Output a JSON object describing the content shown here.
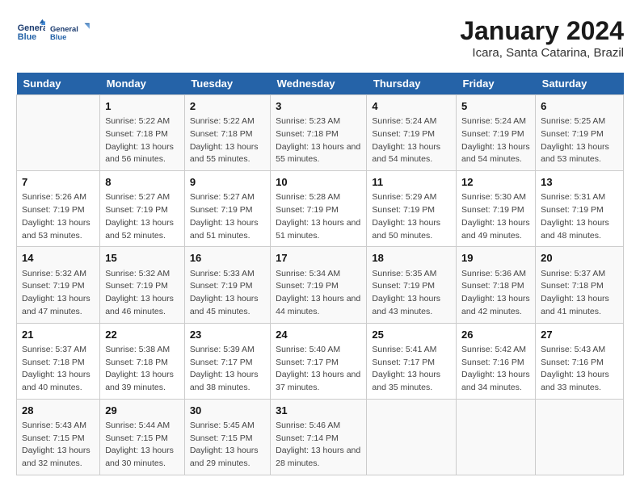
{
  "header": {
    "logo_line1": "General",
    "logo_line2": "Blue",
    "title": "January 2024",
    "subtitle": "Icara, Santa Catarina, Brazil"
  },
  "columns": [
    "Sunday",
    "Monday",
    "Tuesday",
    "Wednesday",
    "Thursday",
    "Friday",
    "Saturday"
  ],
  "weeks": [
    [
      {
        "day": "",
        "sunrise": "",
        "sunset": "",
        "daylight": ""
      },
      {
        "day": "1",
        "sunrise": "Sunrise: 5:22 AM",
        "sunset": "Sunset: 7:18 PM",
        "daylight": "Daylight: 13 hours and 56 minutes."
      },
      {
        "day": "2",
        "sunrise": "Sunrise: 5:22 AM",
        "sunset": "Sunset: 7:18 PM",
        "daylight": "Daylight: 13 hours and 55 minutes."
      },
      {
        "day": "3",
        "sunrise": "Sunrise: 5:23 AM",
        "sunset": "Sunset: 7:18 PM",
        "daylight": "Daylight: 13 hours and 55 minutes."
      },
      {
        "day": "4",
        "sunrise": "Sunrise: 5:24 AM",
        "sunset": "Sunset: 7:19 PM",
        "daylight": "Daylight: 13 hours and 54 minutes."
      },
      {
        "day": "5",
        "sunrise": "Sunrise: 5:24 AM",
        "sunset": "Sunset: 7:19 PM",
        "daylight": "Daylight: 13 hours and 54 minutes."
      },
      {
        "day": "6",
        "sunrise": "Sunrise: 5:25 AM",
        "sunset": "Sunset: 7:19 PM",
        "daylight": "Daylight: 13 hours and 53 minutes."
      }
    ],
    [
      {
        "day": "7",
        "sunrise": "Sunrise: 5:26 AM",
        "sunset": "Sunset: 7:19 PM",
        "daylight": "Daylight: 13 hours and 53 minutes."
      },
      {
        "day": "8",
        "sunrise": "Sunrise: 5:27 AM",
        "sunset": "Sunset: 7:19 PM",
        "daylight": "Daylight: 13 hours and 52 minutes."
      },
      {
        "day": "9",
        "sunrise": "Sunrise: 5:27 AM",
        "sunset": "Sunset: 7:19 PM",
        "daylight": "Daylight: 13 hours and 51 minutes."
      },
      {
        "day": "10",
        "sunrise": "Sunrise: 5:28 AM",
        "sunset": "Sunset: 7:19 PM",
        "daylight": "Daylight: 13 hours and 51 minutes."
      },
      {
        "day": "11",
        "sunrise": "Sunrise: 5:29 AM",
        "sunset": "Sunset: 7:19 PM",
        "daylight": "Daylight: 13 hours and 50 minutes."
      },
      {
        "day": "12",
        "sunrise": "Sunrise: 5:30 AM",
        "sunset": "Sunset: 7:19 PM",
        "daylight": "Daylight: 13 hours and 49 minutes."
      },
      {
        "day": "13",
        "sunrise": "Sunrise: 5:31 AM",
        "sunset": "Sunset: 7:19 PM",
        "daylight": "Daylight: 13 hours and 48 minutes."
      }
    ],
    [
      {
        "day": "14",
        "sunrise": "Sunrise: 5:32 AM",
        "sunset": "Sunset: 7:19 PM",
        "daylight": "Daylight: 13 hours and 47 minutes."
      },
      {
        "day": "15",
        "sunrise": "Sunrise: 5:32 AM",
        "sunset": "Sunset: 7:19 PM",
        "daylight": "Daylight: 13 hours and 46 minutes."
      },
      {
        "day": "16",
        "sunrise": "Sunrise: 5:33 AM",
        "sunset": "Sunset: 7:19 PM",
        "daylight": "Daylight: 13 hours and 45 minutes."
      },
      {
        "day": "17",
        "sunrise": "Sunrise: 5:34 AM",
        "sunset": "Sunset: 7:19 PM",
        "daylight": "Daylight: 13 hours and 44 minutes."
      },
      {
        "day": "18",
        "sunrise": "Sunrise: 5:35 AM",
        "sunset": "Sunset: 7:19 PM",
        "daylight": "Daylight: 13 hours and 43 minutes."
      },
      {
        "day": "19",
        "sunrise": "Sunrise: 5:36 AM",
        "sunset": "Sunset: 7:18 PM",
        "daylight": "Daylight: 13 hours and 42 minutes."
      },
      {
        "day": "20",
        "sunrise": "Sunrise: 5:37 AM",
        "sunset": "Sunset: 7:18 PM",
        "daylight": "Daylight: 13 hours and 41 minutes."
      }
    ],
    [
      {
        "day": "21",
        "sunrise": "Sunrise: 5:37 AM",
        "sunset": "Sunset: 7:18 PM",
        "daylight": "Daylight: 13 hours and 40 minutes."
      },
      {
        "day": "22",
        "sunrise": "Sunrise: 5:38 AM",
        "sunset": "Sunset: 7:18 PM",
        "daylight": "Daylight: 13 hours and 39 minutes."
      },
      {
        "day": "23",
        "sunrise": "Sunrise: 5:39 AM",
        "sunset": "Sunset: 7:17 PM",
        "daylight": "Daylight: 13 hours and 38 minutes."
      },
      {
        "day": "24",
        "sunrise": "Sunrise: 5:40 AM",
        "sunset": "Sunset: 7:17 PM",
        "daylight": "Daylight: 13 hours and 37 minutes."
      },
      {
        "day": "25",
        "sunrise": "Sunrise: 5:41 AM",
        "sunset": "Sunset: 7:17 PM",
        "daylight": "Daylight: 13 hours and 35 minutes."
      },
      {
        "day": "26",
        "sunrise": "Sunrise: 5:42 AM",
        "sunset": "Sunset: 7:16 PM",
        "daylight": "Daylight: 13 hours and 34 minutes."
      },
      {
        "day": "27",
        "sunrise": "Sunrise: 5:43 AM",
        "sunset": "Sunset: 7:16 PM",
        "daylight": "Daylight: 13 hours and 33 minutes."
      }
    ],
    [
      {
        "day": "28",
        "sunrise": "Sunrise: 5:43 AM",
        "sunset": "Sunset: 7:15 PM",
        "daylight": "Daylight: 13 hours and 32 minutes."
      },
      {
        "day": "29",
        "sunrise": "Sunrise: 5:44 AM",
        "sunset": "Sunset: 7:15 PM",
        "daylight": "Daylight: 13 hours and 30 minutes."
      },
      {
        "day": "30",
        "sunrise": "Sunrise: 5:45 AM",
        "sunset": "Sunset: 7:15 PM",
        "daylight": "Daylight: 13 hours and 29 minutes."
      },
      {
        "day": "31",
        "sunrise": "Sunrise: 5:46 AM",
        "sunset": "Sunset: 7:14 PM",
        "daylight": "Daylight: 13 hours and 28 minutes."
      },
      {
        "day": "",
        "sunrise": "",
        "sunset": "",
        "daylight": ""
      },
      {
        "day": "",
        "sunrise": "",
        "sunset": "",
        "daylight": ""
      },
      {
        "day": "",
        "sunrise": "",
        "sunset": "",
        "daylight": ""
      }
    ]
  ]
}
